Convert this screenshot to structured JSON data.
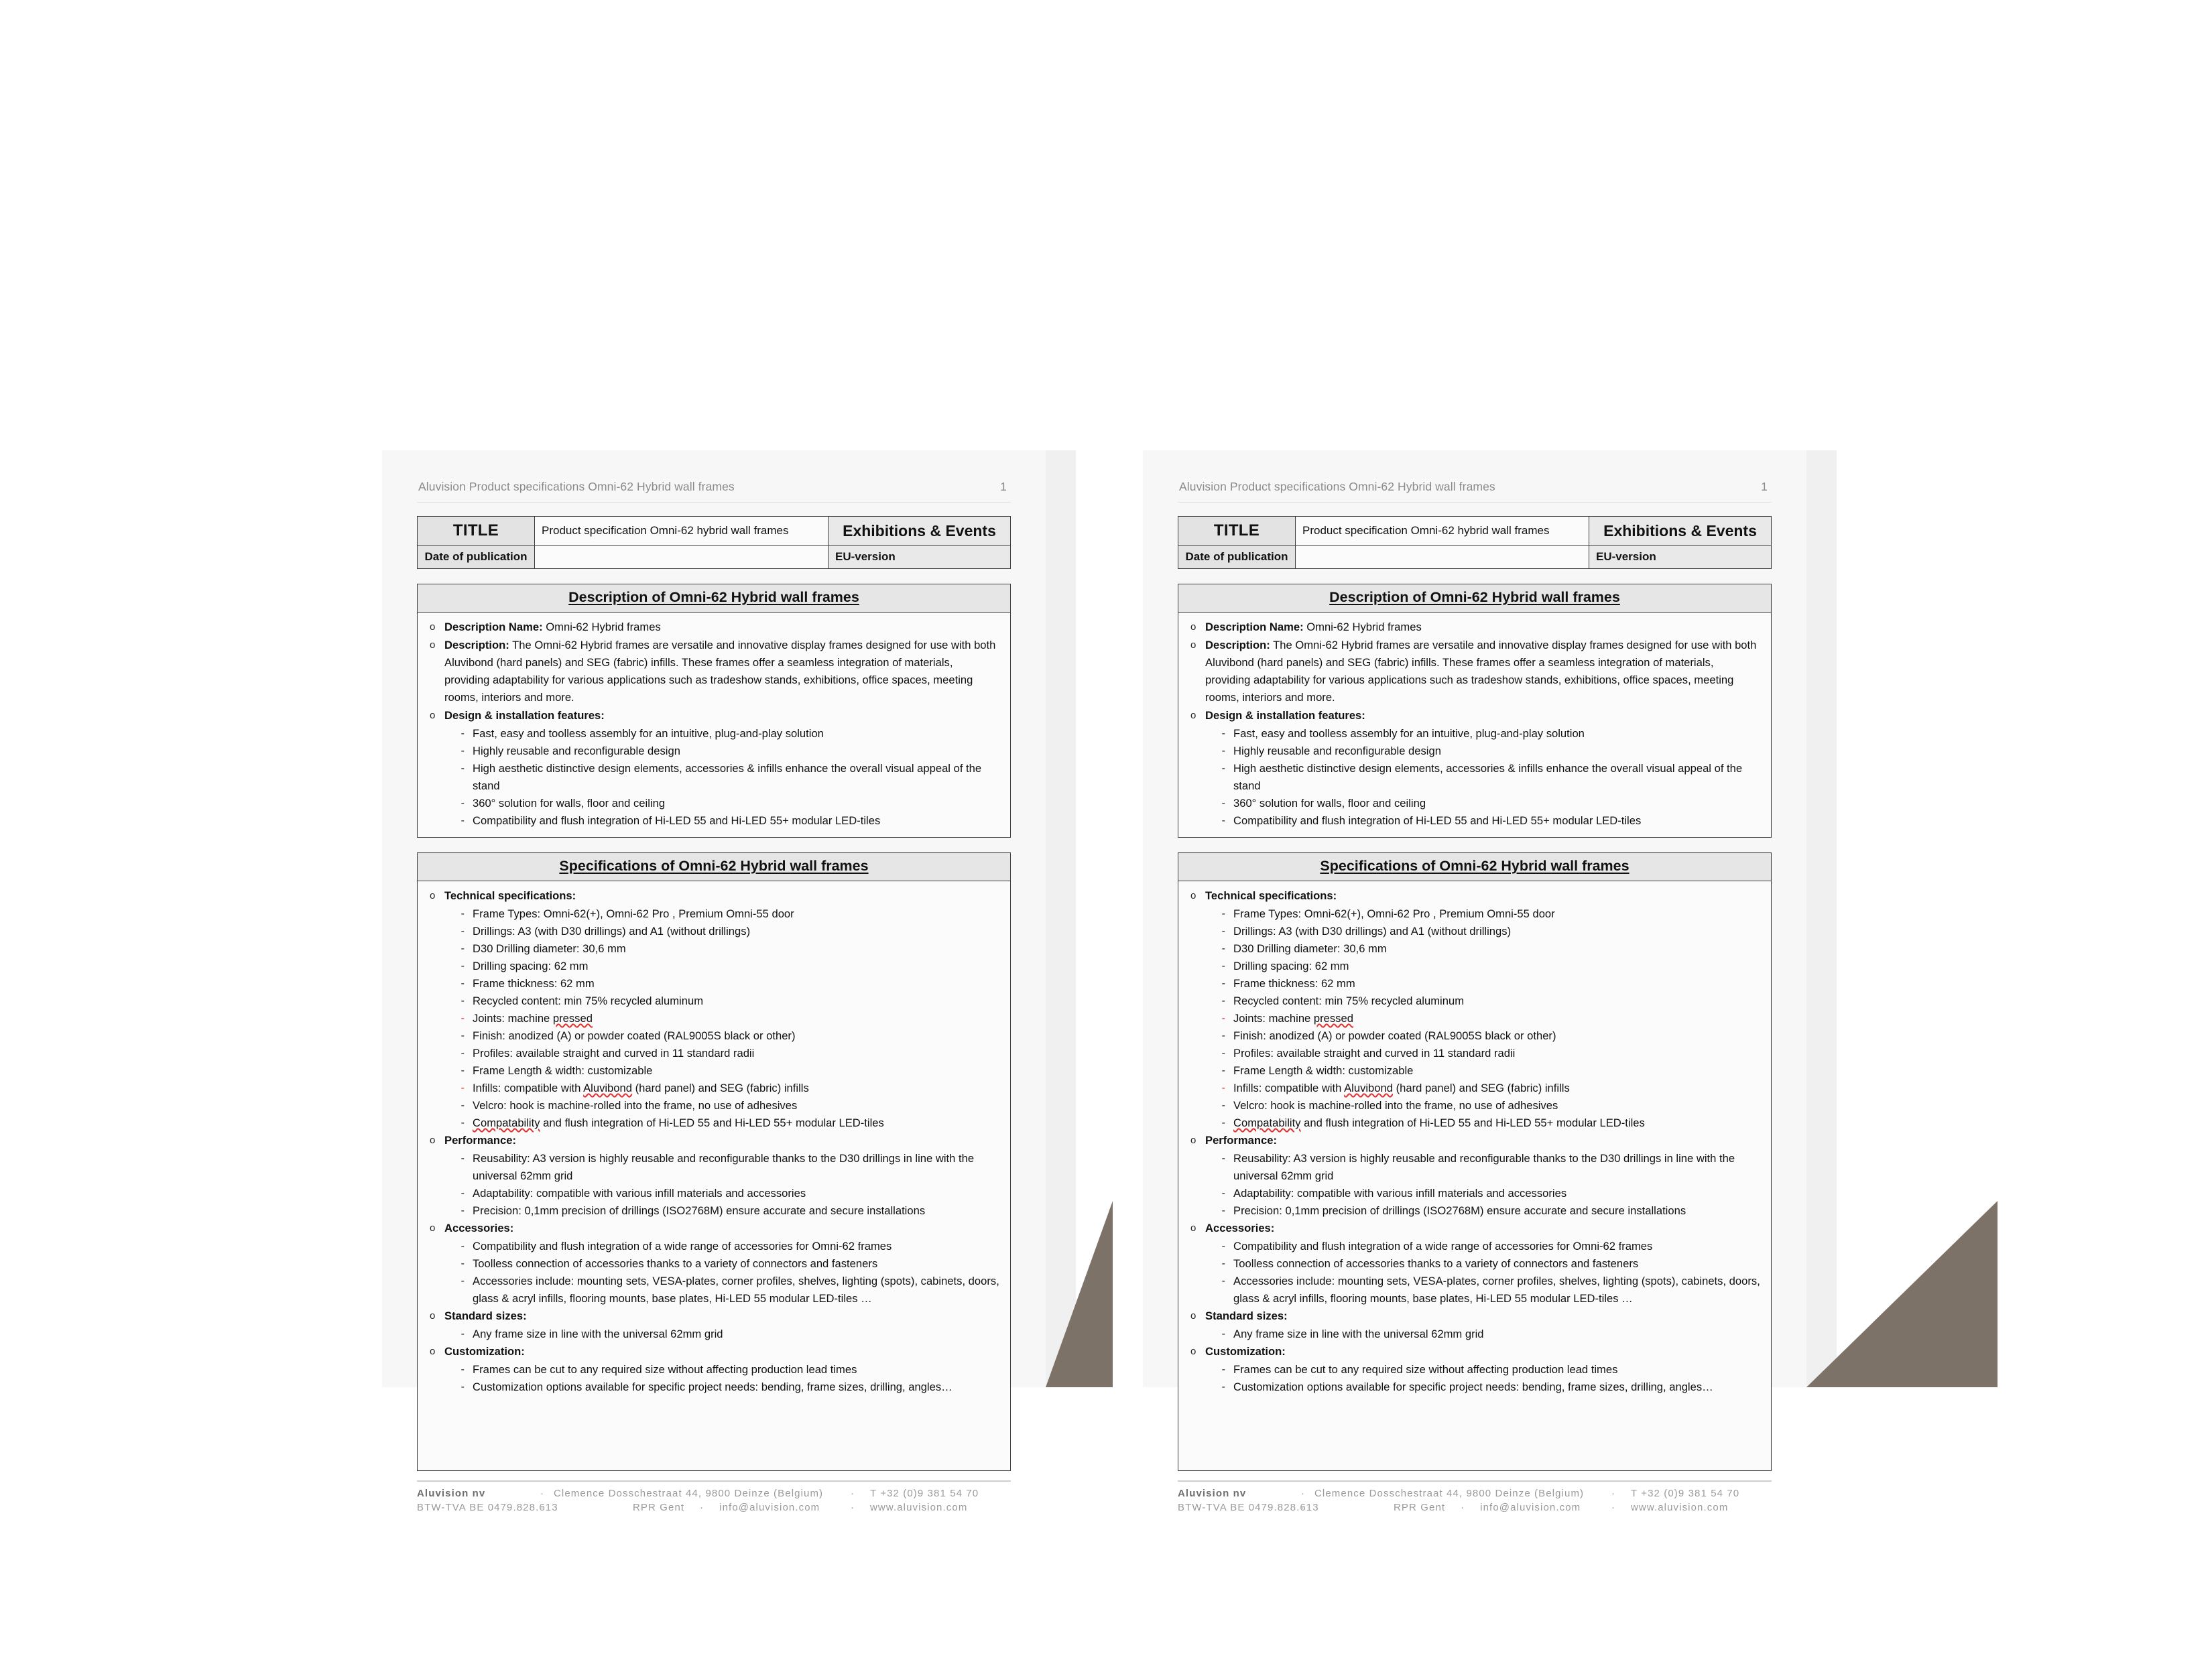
{
  "running_head": {
    "title": "Aluvision Product specifications Omni-62 Hybrid wall frames",
    "page_number": "1"
  },
  "title_table": {
    "title_label": "TITLE",
    "title_value": "Product specification Omni-62 hybrid wall frames",
    "category": "Exhibitions & Events",
    "date_label": "Date of publication",
    "date_value": "",
    "version": "EU-version"
  },
  "description_box": {
    "heading": "Description of Omni-62 Hybrid wall frames",
    "items": [
      {
        "marker": "o",
        "bold": "Description Name:",
        "text": " Omni-62 Hybrid frames"
      },
      {
        "marker": "o",
        "bold": "Description:",
        "text": " The Omni-62 Hybrid frames are versatile and innovative display frames designed for use with both Aluvibond (hard panels) and SEG (fabric) infills. These frames offer a seamless integration of materials, providing adaptability for various applications such as tradeshow stands, exhibitions, office spaces, meeting rooms, interiors and more."
      },
      {
        "marker": "o",
        "bold": "Design & installation features:",
        "text": ""
      }
    ],
    "features": [
      "Fast, easy and toolless assembly for an intuitive, plug-and-play solution",
      "Highly reusable and reconfigurable design",
      "High aesthetic distinctive design elements, accessories & infills enhance the overall visual appeal of the stand",
      "360° solution for walls, floor and ceiling",
      "Compatibility and flush integration of Hi-LED 55 and Hi-LED 55+ modular LED-tiles"
    ]
  },
  "specifications_box": {
    "heading": "Specifications of Omni-62 Hybrid wall frames",
    "groups": [
      {
        "title": "Technical specifications:",
        "items": [
          "Frame Types: Omni-62(+), Omni-62 Pro , Premium Omni-55 door",
          "Drillings: A3 (with D30 drillings) and A1 (without drillings)",
          "D30 Drilling diameter: 30,6 mm",
          "Drilling spacing: 62 mm",
          "Frame thickness: 62 mm",
          "Recycled content: min 75% recycled aluminum",
          "Joints: machine pressed",
          "Finish: anodized (A) or powder coated (RAL9005S black or other)",
          "Profiles: available straight and curved in 11 standard radii",
          "Frame Length & width: customizable",
          "Infills: compatible with Aluvibond (hard panel) and SEG (fabric) infills",
          "Velcro: hook is machine-rolled into the frame, no use of adhesives",
          "Compatability and flush integration of Hi-LED 55 and Hi-LED 55+ modular LED-tiles"
        ]
      },
      {
        "title": "Performance:",
        "items": [
          "Reusability: A3 version is highly reusable and reconfigurable thanks to the D30 drillings in line with the universal 62mm grid",
          "Adaptability: compatible with various infill materials and accessories",
          "Precision: 0,1mm precision of drillings (ISO2768M) ensure accurate and secure installations"
        ]
      },
      {
        "title": "Accessories:",
        "items": [
          "Compatibility and flush integration of a wide range of accessories for Omni-62 frames",
          "Toolless connection of accessories thanks to a variety of connectors and fasteners",
          "Accessories include: mounting sets, VESA-plates, corner profiles, shelves, lighting (spots), cabinets, doors, glass & acryl infills, flooring mounts, base plates, Hi-LED 55 modular LED-tiles …"
        ]
      },
      {
        "title": "Standard sizes:",
        "items": [
          " Any frame size in line with the universal 62mm grid"
        ]
      },
      {
        "title": "Customization:",
        "items": [
          "Frames can be cut to any required size without affecting production lead times",
          "Customization options available for specific project needs: bending, frame sizes, drilling, angles…"
        ]
      }
    ]
  },
  "footer": {
    "company": "Aluvision nv",
    "address": "Clemence Dosschestraat 44, 9800 Deinze (Belgium)",
    "phone": "T +32 (0)9 381 54 70",
    "vat": "BTW-TVA BE 0479.828.613",
    "registry": "RPR Gent",
    "email": "info@aluvision.com",
    "website": "www.aluvision.com",
    "separator": "·"
  },
  "colors": {
    "page_bg": "#f7f7f7",
    "fold_brown": "#7d7268",
    "table_header_gray": "#e3e3e3",
    "border_dark": "#3d3d3d",
    "spellcheck_red": "#e03030"
  }
}
